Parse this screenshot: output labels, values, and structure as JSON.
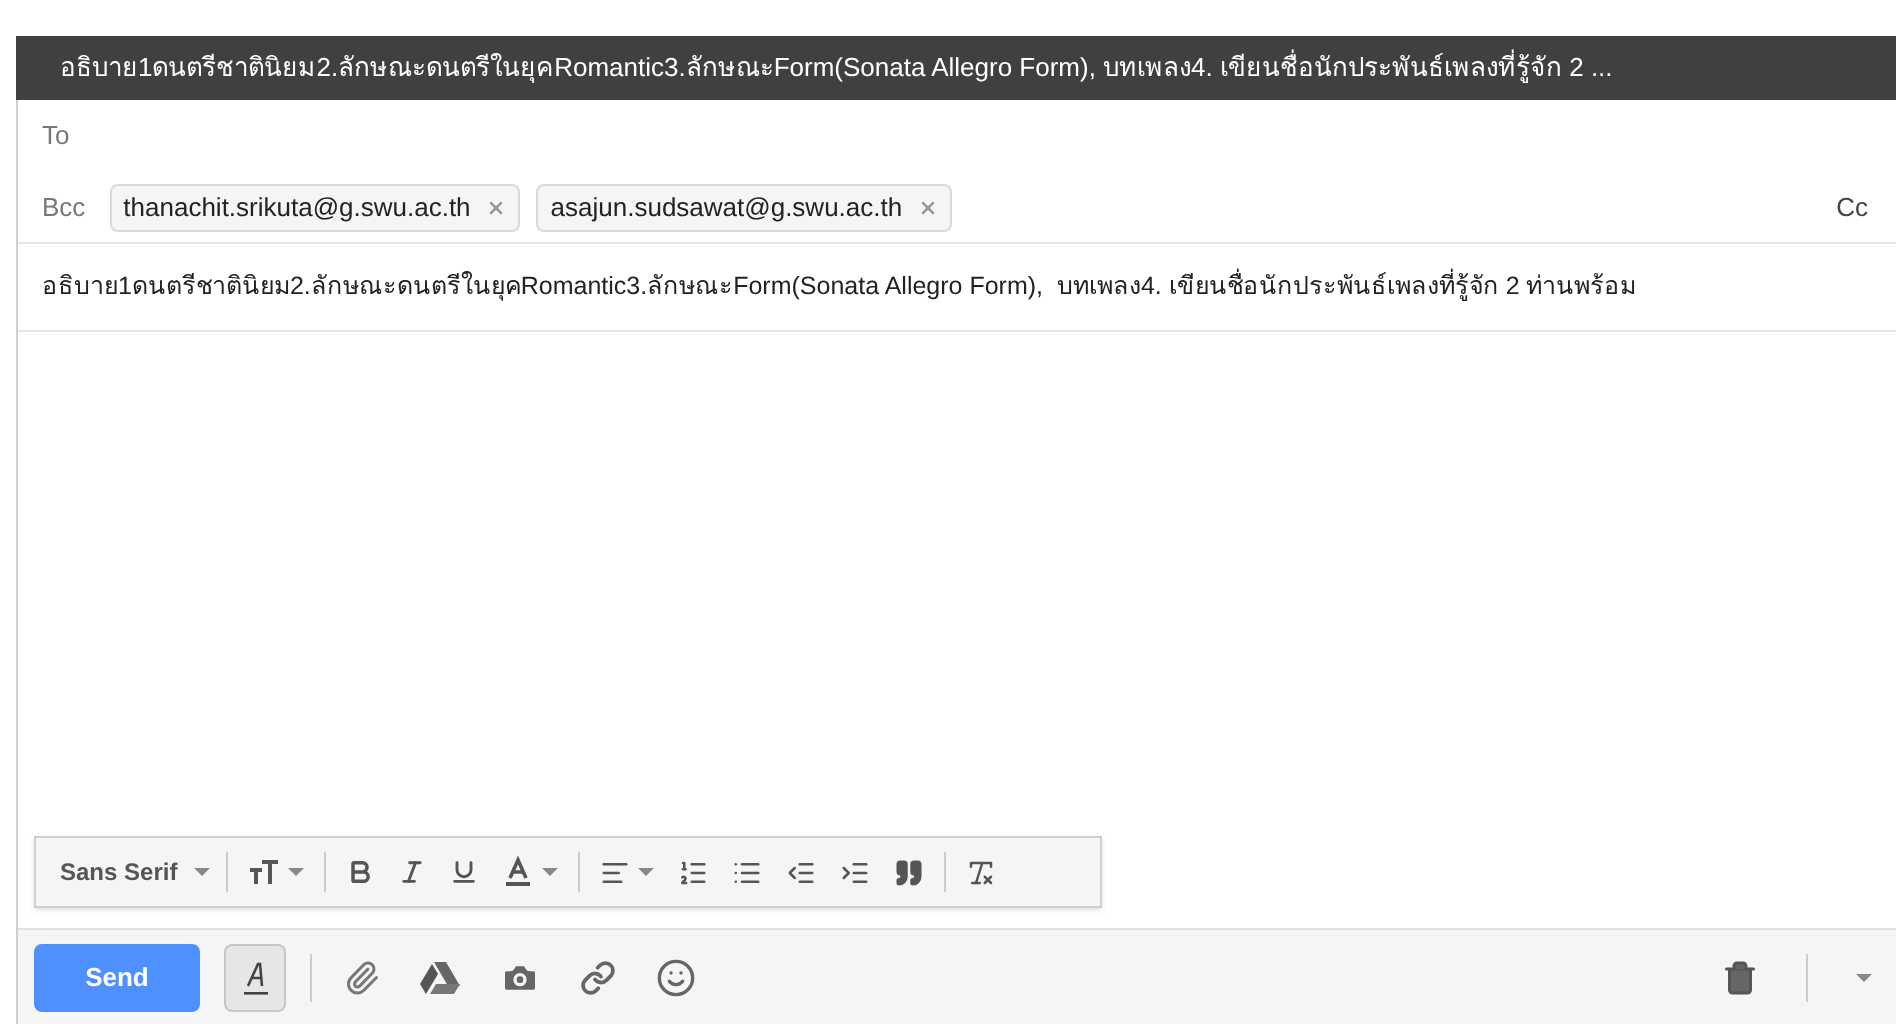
{
  "window": {
    "title": "อธิบาย1ดนตรีชาตินิยม2.ลักษณะดนตรีในยุคRomantic3.ลักษณะForm(Sonata Allegro Form), บทเพลง4. เขียนชื่อนักประพันธ์เพลงที่รู้จัก 2 ..."
  },
  "to": {
    "label": "To"
  },
  "bcc": {
    "label": "Bcc",
    "recipients": [
      {
        "address": "thanachit.srikuta@g.swu.ac.th"
      },
      {
        "address": "asajun.sudsawat@g.swu.ac.th"
      }
    ]
  },
  "cc": {
    "label": "Cc"
  },
  "subject": "อธิบาย1ดนตรีชาตินิยม2.ลักษณะดนตรีในยุคRomantic3.ลักษณะForm(Sonata Allegro Form),  บทเพลง4. เขียนชื่อนักประพันธ์เพลงที่รู้จัก 2 ท่านพร้อม",
  "format_toolbar": {
    "font": "Sans Serif"
  },
  "bottom_bar": {
    "send": "Send",
    "formatting_toggle": {
      "selected": true
    }
  }
}
